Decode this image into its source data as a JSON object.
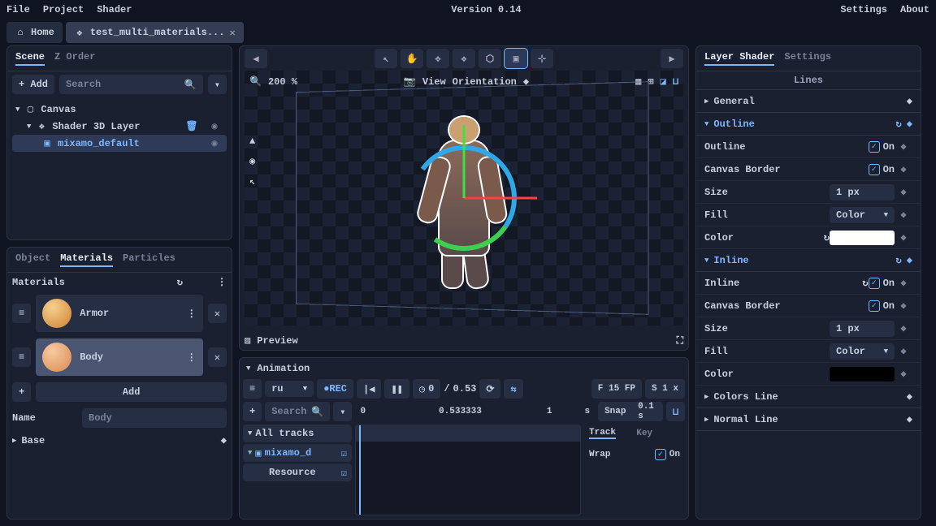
{
  "topbar": {
    "menu": [
      "File",
      "Project",
      "Shader"
    ],
    "version": "Version 0.14",
    "right": [
      "Settings",
      "About"
    ]
  },
  "tabs": {
    "home": "Home",
    "file": "test_multi_materials..."
  },
  "scene": {
    "tabs": [
      "Scene",
      "Z Order"
    ],
    "add": "+ Add",
    "search_ph": "Search",
    "tree": {
      "canvas": "Canvas",
      "layer": "Shader 3D Layer",
      "obj": "mixamo_default"
    }
  },
  "inspector": {
    "tabs": [
      "Object",
      "Materials",
      "Particles"
    ],
    "title": "Materials",
    "items": [
      "Armor",
      "Body"
    ],
    "add": "Add",
    "name_label": "Name",
    "name_value": "Body",
    "base": "Base"
  },
  "viewport": {
    "zoom": "200 %",
    "view": "View",
    "orient": "Orientation",
    "preview": "Preview"
  },
  "animation": {
    "title": "Animation",
    "clip": "ru",
    "cur": "0",
    "sep": "/",
    "dur": "0.53",
    "fps": "F 15 FP",
    "speed": "S 1 x",
    "search_ph": "Search",
    "t0": "0",
    "t1": "0.533333",
    "t2": "1",
    "unit": "s",
    "snap": "Snap",
    "snapv": "0.1 s",
    "all": "All tracks",
    "track1": "mixamo_d",
    "track2": "Resource",
    "trackTab": "Track",
    "keyTab": "Key",
    "wrap": "Wrap",
    "on": "On"
  },
  "shader": {
    "tabs": [
      "Layer Shader",
      "Settings"
    ],
    "sub": "Lines",
    "general": "General",
    "outline": {
      "title": "Outline",
      "outline": "Outline",
      "border": "Canvas Border",
      "size": "Size",
      "sizev": "1 px",
      "fill": "Fill",
      "fillv": "Color",
      "color": "Color",
      "colorv": "#ffffff",
      "on": "On"
    },
    "inline": {
      "title": "Inline",
      "inline": "Inline",
      "border": "Canvas Border",
      "size": "Size",
      "sizev": "1 px",
      "fill": "Fill",
      "fillv": "Color",
      "color": "Color",
      "colorv": "#000000",
      "on": "On"
    },
    "colorsline": "Colors Line",
    "normalline": "Normal Line"
  }
}
